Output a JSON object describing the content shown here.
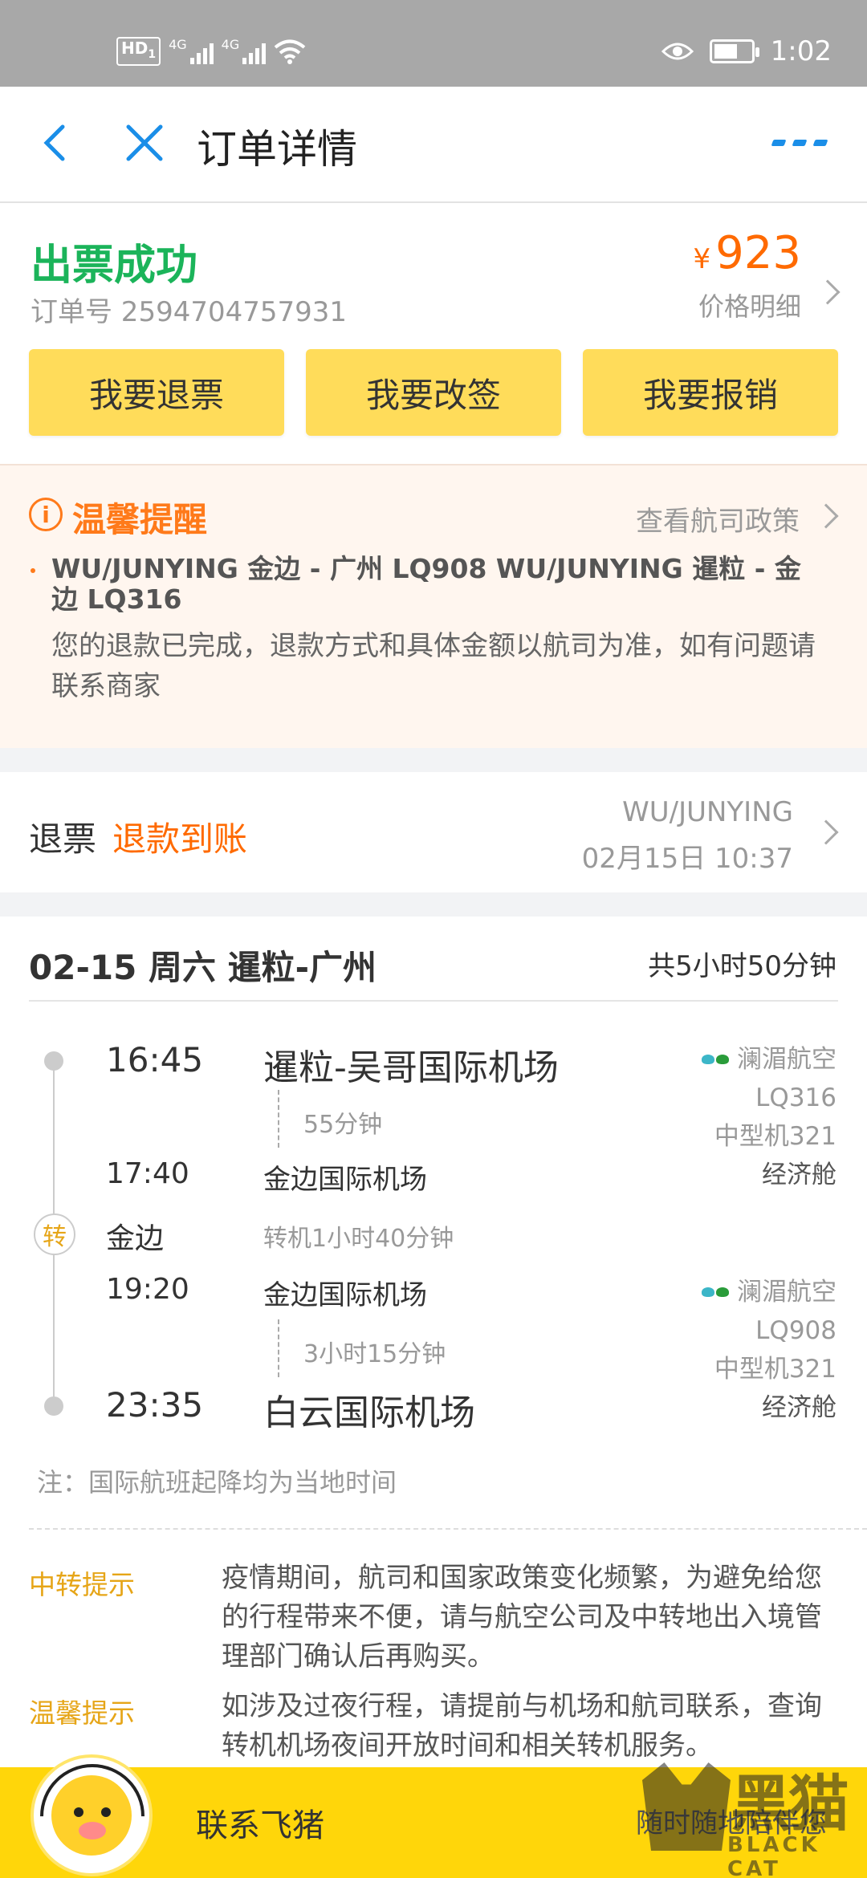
{
  "status_bar": {
    "hd": "HD",
    "hd_sub": "1",
    "net1": "4G",
    "net2": "4G",
    "time": "1:02"
  },
  "nav": {
    "title": "订单详情"
  },
  "order": {
    "status": "出票成功",
    "order_number_label": "订单号 2594704757931",
    "currency": "¥",
    "price": "923",
    "price_detail": "价格明细"
  },
  "actions": [
    {
      "label": "我要退票"
    },
    {
      "label": "我要改签"
    },
    {
      "label": "我要报销"
    }
  ],
  "reminder": {
    "title": "温馨提醒",
    "link": "查看航司政策",
    "flights": "WU/JUNYING 金边 - 广州 LQ908 WU/JUNYING 暹粒 - 金边 LQ316",
    "text": "您的退款已完成，退款方式和具体金额以航司为准，如有问题请联系商家"
  },
  "refund": {
    "label": "退票",
    "status": "退款到账",
    "passenger": "WU/JUNYING",
    "time": "02月15日 10:37"
  },
  "itinerary": {
    "header": "02-15 周六 暹粒-广州",
    "total_duration": "共5小时50分钟",
    "segments": [
      {
        "dep_time": "16:45",
        "dep_airport": "暹粒-吴哥国际机场",
        "duration": "55分钟",
        "arr_time": "17:40",
        "arr_airport": "金边国际机场",
        "airline": "澜湄航空",
        "flight_no": "LQ316",
        "aircraft": "中型机321",
        "cabin": "经济舱"
      },
      {
        "dep_time": "19:20",
        "dep_airport": "金边国际机场",
        "duration": "3小时15分钟",
        "arr_time": "23:35",
        "arr_airport": "白云国际机场",
        "airline": "澜湄航空",
        "flight_no": "LQ908",
        "aircraft": "中型机321",
        "cabin": "经济舱"
      }
    ],
    "transfer": {
      "badge": "转",
      "city": "金边",
      "duration": "转机1小时40分钟"
    },
    "note": "注：国际航班起降均为当地时间",
    "tips": [
      {
        "label": "中转提示",
        "text": "疫情期间，航司和国家政策变化频繁，为避免给您的行程带来不便，请与航空公司及中转地出入境管理部门确认后再购买。"
      },
      {
        "label": "温馨提示",
        "text": "如涉及过夜行程，请提前与机场和航司联系，查询转机机场夜间开放时间和相关转机服务。"
      }
    ]
  },
  "bottom_bar": {
    "contact": "联系飞猪",
    "anytime": "随时随地陪伴您"
  },
  "watermark": {
    "cn": "黑猫",
    "en": "BLACK CAT"
  },
  "colors": {
    "accent_blue": "#1a8ee8",
    "success_green": "#1bb45a",
    "price_orange": "#ff6a00",
    "button_yellow": "#ffdc5a",
    "bottom_yellow": "#ffd60a"
  }
}
